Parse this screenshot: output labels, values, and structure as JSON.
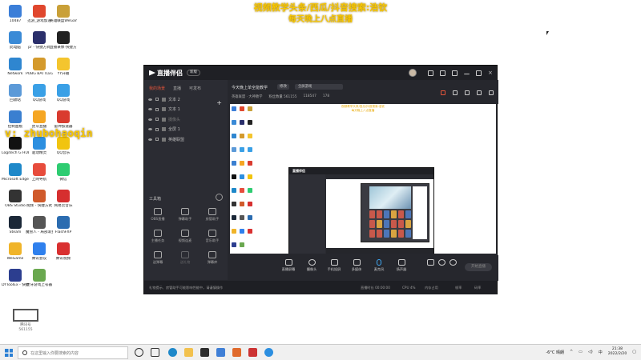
{
  "overlay": {
    "line1": "视频教学头条/西瓜/抖音搜索:浩钦",
    "line2": "每天晚上八点直播",
    "watermark": "v: zhubohaoqin"
  },
  "desktop_icons": [
    {
      "label": "10487",
      "color": "#3b7ed8"
    },
    {
      "label": "迅游_游戏加速",
      "color": "#e0472d"
    },
    {
      "label": "英雄联盟WeGame版",
      "color": "#c9a038"
    },
    {
      "label": "此电脑",
      "color": "#3a8ad6"
    },
    {
      "label": "pr - 快捷方式",
      "color": "#2b2f6b"
    },
    {
      "label": "直播录像·快捷方式",
      "color": "#222222"
    },
    {
      "label": "Network",
      "color": "#2f86d0"
    },
    {
      "label": "PUBG BATTLEGR...",
      "color": "#d49a2c"
    },
    {
      "label": "YY开播",
      "color": "#f4c52e"
    },
    {
      "label": "回收站",
      "color": "#5c9ad8"
    },
    {
      "label": "QQ游戏",
      "color": "#3aa0e6"
    },
    {
      "label": "QQ游戏",
      "color": "#3aa0e6"
    },
    {
      "label": "控制面板",
      "color": "#3a7fd0"
    },
    {
      "label": "虎牙直播",
      "color": "#f5a623"
    },
    {
      "label": "雷神加速器",
      "color": "#d93b2f"
    },
    {
      "label": "Logitech G HUB",
      "color": "#111111"
    },
    {
      "label": "驱动精灵",
      "color": "#2c8fe0"
    },
    {
      "label": "QQ音乐",
      "color": "#f1c40f"
    },
    {
      "label": "Microsoft Edge",
      "color": "#1e88c9"
    },
    {
      "label": "上网导航",
      "color": "#e74c3c"
    },
    {
      "label": "微信",
      "color": "#2ecc71"
    },
    {
      "label": "OBS Studio",
      "color": "#333333"
    },
    {
      "label": "视频 - 快捷方式",
      "color": "#d05a2b"
    },
    {
      "label": "网易云音乐",
      "color": "#d62f2f"
    },
    {
      "label": "Steam",
      "color": "#1b2838"
    },
    {
      "label": "魔兽人 - 局部渐变",
      "color": "#555555"
    },
    {
      "label": "FlashFXP",
      "color": "#2b6cb0"
    },
    {
      "label": "WeGame",
      "color": "#f0b429"
    },
    {
      "label": "腾讯会议",
      "color": "#2f80ed"
    },
    {
      "label": "腾讯视频",
      "color": "#d93030"
    },
    {
      "label": "DYToolEx - 快捷方式",
      "color": "#2c3e8f"
    },
    {
      "label": "虎牙游戏上号器",
      "color": "#6aa84f"
    }
  ],
  "qr": {
    "label": "腾讯号",
    "number": "561155"
  },
  "app": {
    "logo": "直播伴侣",
    "badge": "新版",
    "tabs": [
      "我的场景",
      "直播",
      "可发布"
    ],
    "add_scene": "+",
    "scenes": [
      {
        "label": "文本 2",
        "dim": false
      },
      {
        "label": "文本 1",
        "dim": false
      },
      {
        "label": "摄像头",
        "dim": true
      },
      {
        "label": "全屏 1",
        "dim": false
      },
      {
        "label": "英雄联盟",
        "dim": false
      }
    ],
    "tools_title": "工具箱",
    "tools": [
      {
        "label": "OBS直播",
        "dim": false
      },
      {
        "label": "弹幕助手",
        "dim": false
      },
      {
        "label": "房管助手",
        "dim": false
      },
      {
        "label": "主播任务",
        "dim": false
      },
      {
        "label": "视频连麦",
        "dim": false
      },
      {
        "label": "音乐助手",
        "dim": false
      },
      {
        "label": "送弹幕",
        "dim": false
      },
      {
        "label": "送礼物",
        "dim": true
      },
      {
        "label": "弹幕库",
        "dim": false
      }
    ],
    "stream_title": "今天晚上单全能教学",
    "edit": "修改",
    "game_select": "全屏游戏",
    "stats": [
      "英雄联盟 · 大神教学",
      "粉丝数量 561155",
      "118547",
      "178"
    ],
    "preview_caption1": "视频教学头条/西瓜/抖音搜索:浩钦",
    "preview_caption2": "每天晚上八点直播",
    "controls": [
      "直播屏幕",
      "摄像头",
      "手机投屏",
      "多媒体",
      "麦克风",
      "扬声器"
    ],
    "go_live": "开始直播",
    "status_msg": "礼物提示、房管助手可能影响性能中，请谨慎操作",
    "status_items": [
      "直播时长 00:00:00",
      "CPU 4%",
      "内存占用",
      "帧率",
      "码率"
    ]
  },
  "taskbar": {
    "search_placeholder": "在这里输入你要搜索的内容",
    "weather": "-6°C 晴朗",
    "time": "21:38",
    "date": "2022/2/20",
    "lang": "中"
  }
}
